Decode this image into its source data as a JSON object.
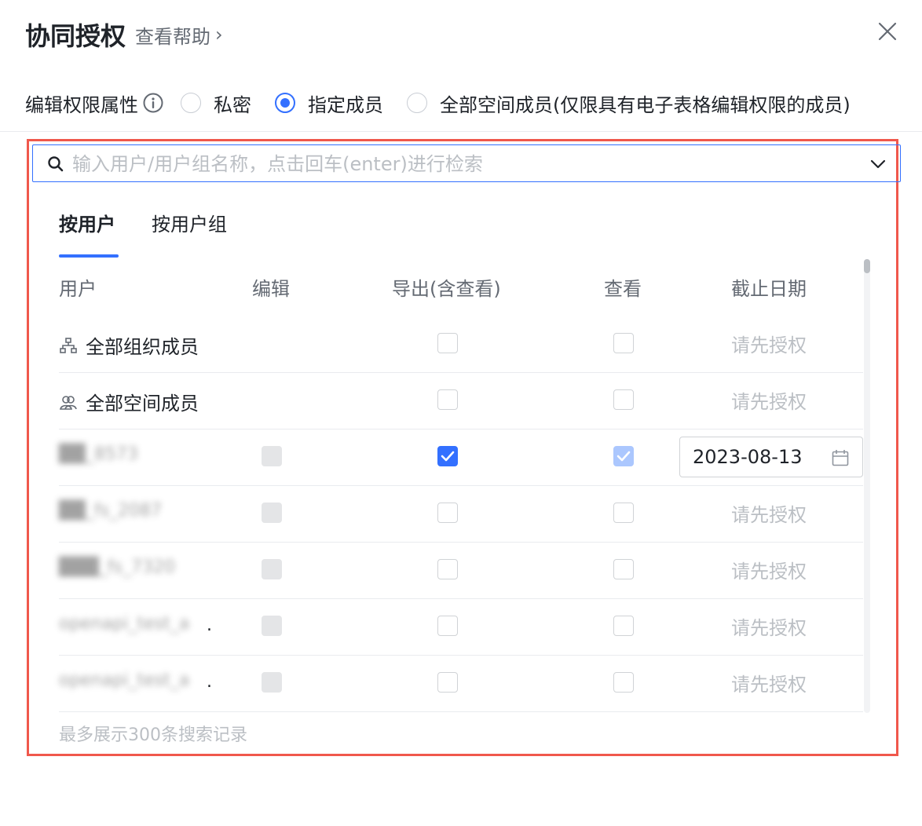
{
  "header": {
    "title": "协同授权",
    "help_link": "查看帮助"
  },
  "permission": {
    "label": "编辑权限属性",
    "options": [
      {
        "label": "私密",
        "selected": false
      },
      {
        "label": "指定成员",
        "selected": true
      },
      {
        "label": "全部空间成员(仅限具有电子表格编辑权限的成员)",
        "selected": false
      }
    ]
  },
  "search": {
    "placeholder": "输入用户/用户组名称，点击回车(enter)进行检索",
    "value": ""
  },
  "tabs": [
    {
      "label": "按用户",
      "active": true
    },
    {
      "label": "按用户组",
      "active": false
    }
  ],
  "table": {
    "columns": [
      "用户",
      "编辑",
      "导出(含查看)",
      "查看",
      "截止日期"
    ],
    "rows": [
      {
        "user": "全部组织成员",
        "icon": "org-tree-icon",
        "edit": null,
        "export": false,
        "view": false,
        "deadline": "请先授权"
      },
      {
        "user": "全部空间成员",
        "icon": "group-users-icon",
        "edit": null,
        "export": false,
        "view": false,
        "deadline": "请先授权"
      },
      {
        "user": "██_8573",
        "blurred": true,
        "edit": "disabled",
        "export": true,
        "view": "checked-disabled",
        "deadline": "2023-08-13"
      },
      {
        "user": "██_fs_2087",
        "blurred": true,
        "edit": "disabled",
        "export": false,
        "view": false,
        "deadline": "请先授权"
      },
      {
        "user": "███_fs_7320",
        "blurred": true,
        "edit": "disabled",
        "export": false,
        "view": false,
        "deadline": "请先授权"
      },
      {
        "user": "openapi_test_a",
        "blurred": true,
        "truncated": true,
        "edit": "disabled",
        "export": false,
        "view": false,
        "deadline": "请先授权"
      },
      {
        "user": "openapi_test_a",
        "blurred": true,
        "truncated": true,
        "edit": "disabled",
        "export": false,
        "view": false,
        "deadline": "请先授权"
      }
    ],
    "ellipsis": "."
  },
  "footer_note": "最多展示300条搜索记录",
  "colors": {
    "accent": "#3370ff",
    "highlight_border": "#f0584c",
    "muted": "#bbbfc4"
  }
}
